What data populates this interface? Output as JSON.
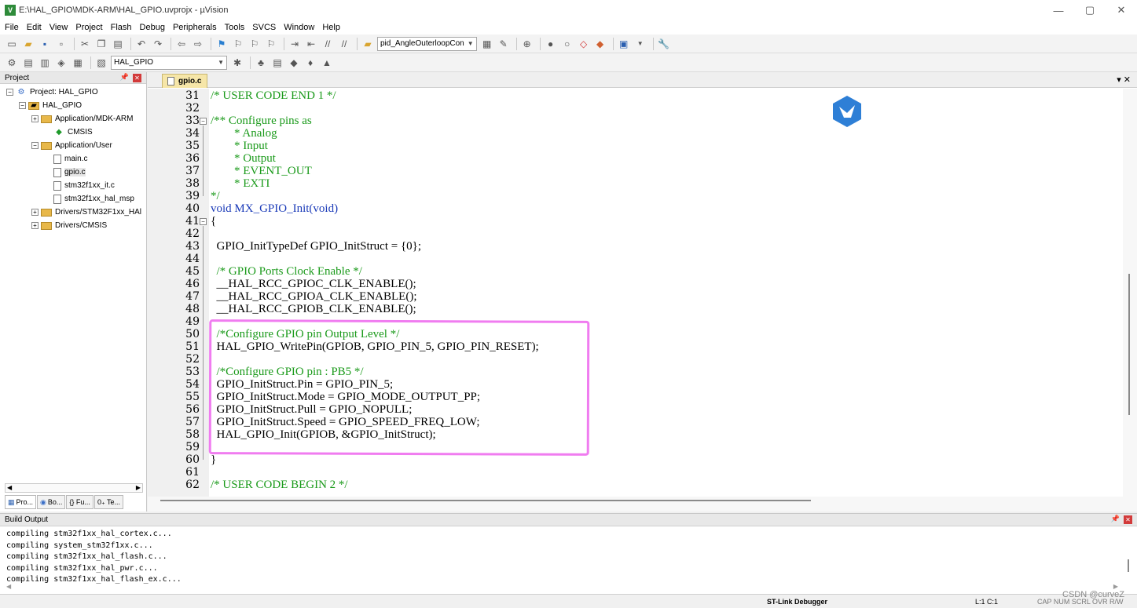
{
  "window": {
    "title": "E:\\HAL_GPIO\\MDK-ARM\\HAL_GPIO.uvprojx - µVision",
    "app_icon_text": "V"
  },
  "menu": [
    "File",
    "Edit",
    "View",
    "Project",
    "Flash",
    "Debug",
    "Peripherals",
    "Tools",
    "SVCS",
    "Window",
    "Help"
  ],
  "toolbar": {
    "function_combo": "pid_AngleOuterloopCon",
    "target_combo": "HAL_GPIO"
  },
  "project_panel": {
    "title": "Project",
    "tree": [
      {
        "label": "Project: HAL_GPIO",
        "level": 0,
        "expander": "⊟",
        "icon": "project-icon"
      },
      {
        "label": "HAL_GPIO",
        "level": 1,
        "expander": "⊟",
        "icon": "target-icon"
      },
      {
        "label": "Application/MDK-ARM",
        "level": 2,
        "expander": "⊞",
        "icon": "folder-icon"
      },
      {
        "label": "CMSIS",
        "level": 3,
        "expander": "",
        "icon": "cmsis-gem-icon"
      },
      {
        "label": "Application/User",
        "level": 2,
        "expander": "⊟",
        "icon": "folder-icon"
      },
      {
        "label": "main.c",
        "level": 3,
        "expander": "",
        "icon": "file-icon"
      },
      {
        "label": "gpio.c",
        "level": 3,
        "expander": "",
        "icon": "file-icon",
        "selected": true
      },
      {
        "label": "stm32f1xx_it.c",
        "level": 3,
        "expander": "",
        "icon": "file-icon"
      },
      {
        "label": "stm32f1xx_hal_msp",
        "level": 3,
        "expander": "",
        "icon": "file-icon"
      },
      {
        "label": "Drivers/STM32F1xx_HAl",
        "level": 2,
        "expander": "⊞",
        "icon": "folder-icon"
      },
      {
        "label": "Drivers/CMSIS",
        "level": 2,
        "expander": "⊞",
        "icon": "folder-icon"
      }
    ],
    "tabs": [
      {
        "label": "Pro..."
      },
      {
        "label": "Bo..."
      },
      {
        "label": "{} Fu..."
      },
      {
        "label": "0₊ Te..."
      }
    ]
  },
  "editor": {
    "active_tab": "gpio.c",
    "lines": [
      {
        "n": "31",
        "text": "/* USER CODE END 1 */",
        "cls": "c-comment"
      },
      {
        "n": "32",
        "text": "",
        "cls": ""
      },
      {
        "n": "33",
        "text": "/** Configure pins as",
        "cls": "c-comment"
      },
      {
        "n": "34",
        "text": "        * Analog",
        "cls": "c-comment"
      },
      {
        "n": "35",
        "text": "        * Input",
        "cls": "c-comment"
      },
      {
        "n": "36",
        "text": "        * Output",
        "cls": "c-comment"
      },
      {
        "n": "37",
        "text": "        * EVENT_OUT",
        "cls": "c-comment"
      },
      {
        "n": "38",
        "text": "        * EXTI",
        "cls": "c-comment"
      },
      {
        "n": "39",
        "text": "*/",
        "cls": "c-comment"
      },
      {
        "n": "40",
        "text": "void MX_GPIO_Init(void)",
        "cls": "c-kw"
      },
      {
        "n": "41",
        "text": "{",
        "cls": ""
      },
      {
        "n": "42",
        "text": "",
        "cls": ""
      },
      {
        "n": "43",
        "text": "  GPIO_InitTypeDef GPIO_InitStruct = {0};",
        "cls": ""
      },
      {
        "n": "44",
        "text": "",
        "cls": ""
      },
      {
        "n": "45",
        "text": "  /* GPIO Ports Clock Enable */",
        "cls": "c-comment"
      },
      {
        "n": "46",
        "text": "  __HAL_RCC_GPIOC_CLK_ENABLE();",
        "cls": ""
      },
      {
        "n": "47",
        "text": "  __HAL_RCC_GPIOA_CLK_ENABLE();",
        "cls": ""
      },
      {
        "n": "48",
        "text": "  __HAL_RCC_GPIOB_CLK_ENABLE();",
        "cls": ""
      },
      {
        "n": "49",
        "text": "",
        "cls": ""
      },
      {
        "n": "50",
        "text": "  /*Configure GPIO pin Output Level */",
        "cls": "c-comment"
      },
      {
        "n": "51",
        "text": "  HAL_GPIO_WritePin(GPIOB, GPIO_PIN_5, GPIO_PIN_RESET);",
        "cls": ""
      },
      {
        "n": "52",
        "text": "",
        "cls": ""
      },
      {
        "n": "53",
        "text": "  /*Configure GPIO pin : PB5 */",
        "cls": "c-comment"
      },
      {
        "n": "54",
        "text": "  GPIO_InitStruct.Pin = GPIO_PIN_5;",
        "cls": ""
      },
      {
        "n": "55",
        "text": "  GPIO_InitStruct.Mode = GPIO_MODE_OUTPUT_PP;",
        "cls": ""
      },
      {
        "n": "56",
        "text": "  GPIO_InitStruct.Pull = GPIO_NOPULL;",
        "cls": ""
      },
      {
        "n": "57",
        "text": "  GPIO_InitStruct.Speed = GPIO_SPEED_FREQ_LOW;",
        "cls": ""
      },
      {
        "n": "58",
        "text": "  HAL_GPIO_Init(GPIOB, &GPIO_InitStruct);",
        "cls": ""
      },
      {
        "n": "59",
        "text": "",
        "cls": ""
      },
      {
        "n": "60",
        "text": "}",
        "cls": ""
      },
      {
        "n": "61",
        "text": "",
        "cls": ""
      },
      {
        "n": "62",
        "text": "/* USER CODE BEGIN 2 */",
        "cls": "c-comment"
      }
    ],
    "annotation_color": "#f07cf0"
  },
  "build_output": {
    "title": "Build Output",
    "lines": [
      "compiling stm32f1xx_hal_cortex.c...",
      "compiling system_stm32f1xx.c...",
      "compiling stm32f1xx_hal_flash.c...",
      "compiling stm32f1xx_hal_pwr.c...",
      "compiling stm32f1xx_hal_flash_ex.c..."
    ]
  },
  "status": {
    "debugger": "ST-Link Debugger",
    "position": "L:1 C:1",
    "keys": "CAP  NUM  SCRL  OVR  R/W",
    "watermark": "CSDN @curveZ"
  },
  "colors": {
    "comment": "#1a9a1a",
    "keyword": "#1a3ab8",
    "number": "#1a9a9a",
    "tab_active": "#f6e6a8"
  }
}
